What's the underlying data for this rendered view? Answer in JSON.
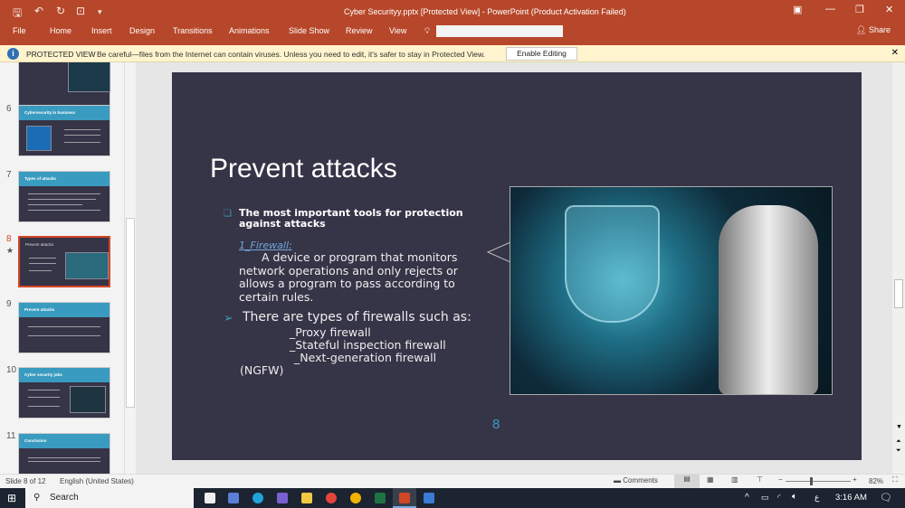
{
  "window": {
    "title": "Cyber Securityy.pptx [Protected View] - PowerPoint (Product Activation Failed)"
  },
  "ribbon": {
    "tabs": [
      "File",
      "Home",
      "Insert",
      "Design",
      "Transitions",
      "Animations",
      "Slide Show",
      "Review",
      "View"
    ],
    "share": "Share"
  },
  "protected_view": {
    "label": "PROTECTED VIEW",
    "message": "Be careful—files from the Internet can contain viruses. Unless you need to edit, it's safer to stay in Protected View.",
    "button": "Enable Editing"
  },
  "thumbnails": [
    {
      "num": "6",
      "title": "Cybersecurity in business"
    },
    {
      "num": "7",
      "title": "Types of attacks"
    },
    {
      "num": "8",
      "title": "Prevent attacks"
    },
    {
      "num": "9",
      "title": "Prevent attacks"
    },
    {
      "num": "10",
      "title": "Cyber security jobs"
    },
    {
      "num": "11",
      "title": "Conclusion"
    }
  ],
  "slide": {
    "title": "Prevent attacks",
    "bullet1": "The most important tools for protection against attacks",
    "firewall_link": "1_Firewall:",
    "firewall_desc": "A device or program that monitors network operations and only rejects or allows a program to pass according to certain rules.",
    "bullet2": "There are types of firewalls such as:",
    "types": [
      "_Proxy firewall",
      "_Stateful inspection firewall",
      "_Next-generation firewall"
    ],
    "ngfw": "(NGFW)",
    "page_number": "8"
  },
  "status": {
    "slide": "Slide 8 of 12",
    "language": "English (United States)",
    "comments": "Comments",
    "zoom": "82%",
    "zoom_percent": 82
  },
  "taskbar": {
    "search": "Search",
    "time": "3:16 AM",
    "lang": "ع"
  },
  "colors": {
    "accent": "#b7472a",
    "slide_bg": "#363447",
    "slide_accent": "#3a9bc0"
  }
}
